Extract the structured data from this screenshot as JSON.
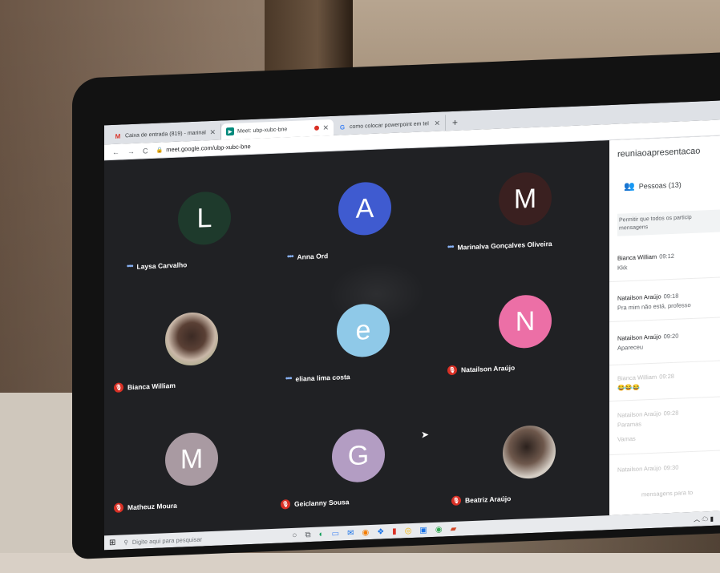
{
  "browser": {
    "tabs": [
      {
        "title": "Caixa de entrada (819) - marinal"
      },
      {
        "title": "Meet: ubp-xubc-bne"
      },
      {
        "title": "como colocar powerpoint em tel"
      }
    ],
    "new_tab": "+",
    "close": "✕",
    "url": "meet.google.com/ubp-xubc-bne",
    "nav_back": "←",
    "nav_forward": "→",
    "nav_reload": "C"
  },
  "participants": [
    {
      "name": "Laysa Carvalho",
      "initial": "L",
      "color": "#1e3a2c"
    },
    {
      "name": "Anna Ord",
      "initial": "A",
      "color": "#3f5bd0"
    },
    {
      "name": "Marinalva Gonçalves Oliveira",
      "initial": "M",
      "color": "#3a2020"
    },
    {
      "name": "Bianca William",
      "initial": "",
      "color": ""
    },
    {
      "name": "eliana lima costa",
      "initial": "e",
      "color": "#8fc9e8"
    },
    {
      "name": "Natailson Araújo",
      "initial": "N",
      "color": "#ec6fa6"
    },
    {
      "name": "Matheuz Moura",
      "initial": "M",
      "color": "#a99aa2"
    },
    {
      "name": "Geiclanny Sousa",
      "initial": "G",
      "color": "#b39dc3"
    },
    {
      "name": "Beatriz Araújo",
      "initial": "",
      "color": ""
    }
  ],
  "panel": {
    "title": "reuniaoapresentacao",
    "people_label": "Pessoas (13)",
    "allow_messages": "Permitir que todos os particip mensagens",
    "messages": [
      {
        "from": "Bianca William",
        "time": "09:12",
        "text": "Kkk"
      },
      {
        "from": "Natailson Araújo",
        "time": "09:18",
        "text": "Pra mim não está, professo"
      },
      {
        "from": "Natailson Araújo",
        "time": "09:20",
        "text": "Apareceu"
      },
      {
        "from": "Bianca William",
        "time": "09:28",
        "text": "😂😂😂"
      },
      {
        "from": "Natailson Araújo",
        "time": "09:28",
        "text": "Paramas"
      },
      {
        "from": "",
        "time": "",
        "text": "Vamas"
      },
      {
        "from": "Natailson Araújo",
        "time": "09:30",
        "text": ""
      },
      {
        "from": "",
        "time": "",
        "text": "mensagens para to"
      }
    ]
  },
  "taskbar": {
    "search_placeholder": "Digite aqui para pesquisar"
  },
  "colors": {
    "meet_bg": "#202124",
    "mic_off": "#d93025",
    "speaking_dots": "#8ab4f8"
  }
}
